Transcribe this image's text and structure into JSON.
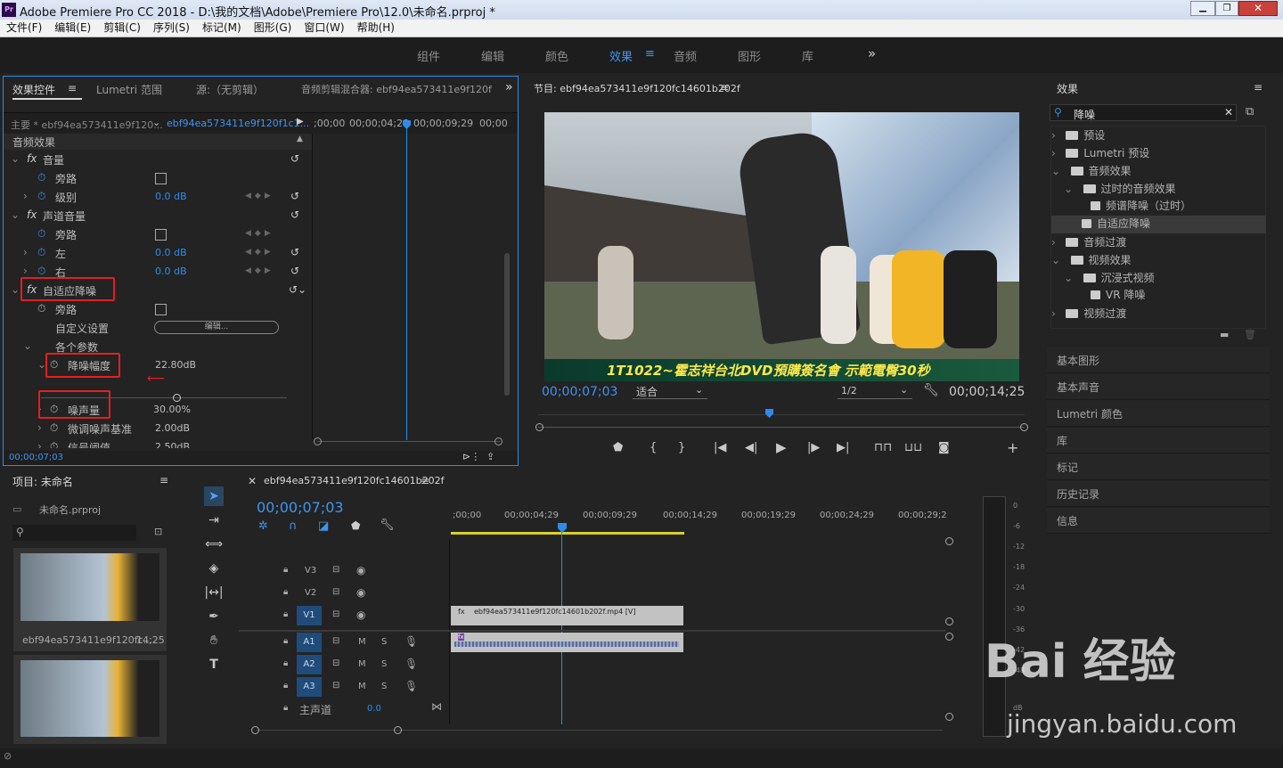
{
  "app": {
    "title": "Adobe Premiere Pro CC 2018 - D:\\我的文档\\Adobe\\Premiere Pro\\12.0\\未命名.prproj *",
    "logo": "Pr"
  },
  "menu": [
    "文件(F)",
    "编辑(E)",
    "剪辑(C)",
    "序列(S)",
    "标记(M)",
    "图形(G)",
    "窗口(W)",
    "帮助(H)"
  ],
  "workspaces": [
    "组件",
    "编辑",
    "颜色",
    "效果",
    "音频",
    "图形",
    "库"
  ],
  "workspace_active": "效果",
  "effect_controls": {
    "tabs": [
      "效果控件",
      "Lumetri 范围",
      "源:（无剪辑）",
      "音频剪辑混合器: ebf94ea573411e9f120f"
    ],
    "master": "主要 * ebf94ea573411e9f120...",
    "clip": "ebf94ea573411e9f120f1c1...",
    "ruler": [
      ";00;00",
      "00;00;04;29",
      "00;00;09;29",
      "00;00"
    ],
    "section": "音频效果",
    "rows": [
      {
        "label": "音量",
        "kind": "fx"
      },
      {
        "label": "旁路",
        "kind": "check"
      },
      {
        "label": "级别",
        "value": "0.0 dB"
      },
      {
        "label": "声道音量",
        "kind": "fx"
      },
      {
        "label": "旁路",
        "kind": "check"
      },
      {
        "label": "左",
        "value": "0.0 dB"
      },
      {
        "label": "右",
        "value": "0.0 dB"
      },
      {
        "label": "自适应降噪",
        "kind": "fx"
      },
      {
        "label": "旁路",
        "kind": "check"
      },
      {
        "label": "自定义设置",
        "button": "编辑..."
      },
      {
        "label": "各个参数"
      },
      {
        "label": "降噪幅度",
        "value": "22.80dB"
      },
      {
        "label": "噪声量",
        "value": "30.00%"
      },
      {
        "label": "微调噪声基准",
        "value": "2.00dB"
      },
      {
        "label": "信号阈值",
        "value": "2.50dB"
      }
    ],
    "timecode": "00;00;07;03"
  },
  "program": {
    "title": "节目: ebf94ea573411e9f120fc14601b202f",
    "timecode": "00;00;07;03",
    "fit": "适合",
    "res": "1/2",
    "duration": "00;00;14;25",
    "caption": "1T1022~霍志祥台北DVD預購簽名會  示範電臀30秒"
  },
  "effects_panel": {
    "title": "效果",
    "search": "降噪",
    "tree": [
      {
        "label": "预设",
        "level": 0
      },
      {
        "label": "Lumetri 预设",
        "level": 0
      },
      {
        "label": "音频效果",
        "level": 0
      },
      {
        "label": "过时的音频效果",
        "level": 1
      },
      {
        "label": "频谱降噪（过时）",
        "level": 2
      },
      {
        "label": "自适应降噪",
        "level": 2,
        "selected": true
      },
      {
        "label": "音频过渡",
        "level": 0
      },
      {
        "label": "视频效果",
        "level": 0
      },
      {
        "label": "沉浸式视频",
        "level": 1
      },
      {
        "label": "VR 降噪",
        "level": 2
      },
      {
        "label": "视频过渡",
        "level": 0
      }
    ],
    "sections": [
      "基本图形",
      "基本声音",
      "Lumetri 颜色",
      "库",
      "标记",
      "历史记录",
      "信息"
    ]
  },
  "project": {
    "title": "项目: 未命名",
    "file": "未命名.prproj",
    "clip_name": "ebf94ea573411e9f120fc...",
    "clip_dur": "14;25"
  },
  "timeline": {
    "title": "ebf94ea573411e9f120fc14601b202f",
    "timecode": "00;00;07;03",
    "ruler": [
      ";00;00",
      "00;00;04;29",
      "00;00;09;29",
      "00;00;14;29",
      "00;00;19;29",
      "00;00;24;29",
      "00;00;29;2"
    ],
    "tracks": [
      "V3",
      "V2",
      "V1",
      "A1",
      "A2",
      "A3"
    ],
    "master": "主声道",
    "master_val": "0.0",
    "clip": "ebf94ea573411e9f120fc14601b202f.mp4 [V]"
  },
  "meter": {
    "scale": [
      "0",
      "-6",
      "-12",
      "-18",
      "-24",
      "-30",
      "-36",
      "-42",
      "-48",
      "dB"
    ]
  },
  "watermark": {
    "logo": "Bai 经验",
    "url": "jingyan.baidu.com"
  }
}
